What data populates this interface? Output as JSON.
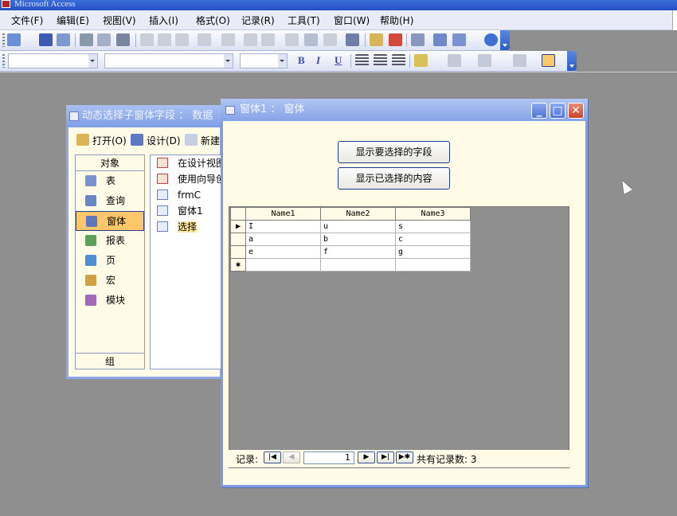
{
  "app": {
    "title": "Microsoft Access"
  },
  "menu": {
    "items": [
      "文件(F)",
      "编辑(E)",
      "视图(V)",
      "插入(I)",
      "格式(O)",
      "记录(R)",
      "工具(T)",
      "窗口(W)",
      "帮助(H)"
    ]
  },
  "db_window": {
    "title": "动态选择子窗体字段 ： 数据",
    "toolbar": {
      "open": "打开(O)",
      "design": "设计(D)",
      "new": "新建"
    },
    "objects_header": "对象",
    "objects": [
      "表",
      "查询",
      "窗体",
      "报表",
      "页",
      "宏",
      "模块"
    ],
    "selected_object": "窗体",
    "groups_label": "组",
    "list_items": [
      "在设计视图",
      "使用向导创",
      "frmC",
      "窗体1",
      "选择"
    ]
  },
  "form_window": {
    "title": "窗体1 ： 窗体",
    "button_show_fields": "显示要选择的字段",
    "button_show_selected": "显示已选择的内容",
    "grid": {
      "columns": [
        "Name1",
        "Name2",
        "Name3"
      ],
      "rows": [
        [
          "I",
          "u",
          "s"
        ],
        [
          "a",
          "b",
          "c"
        ],
        [
          "e",
          "f",
          "g"
        ]
      ]
    },
    "nav": {
      "label": "记录:",
      "current": "1",
      "total_text": "共有记录数: 3"
    }
  },
  "colors": {
    "selected_object_bg": "#fbc76a",
    "form_bg": "#fffbe6",
    "app_bg": "#8f8f8f"
  }
}
